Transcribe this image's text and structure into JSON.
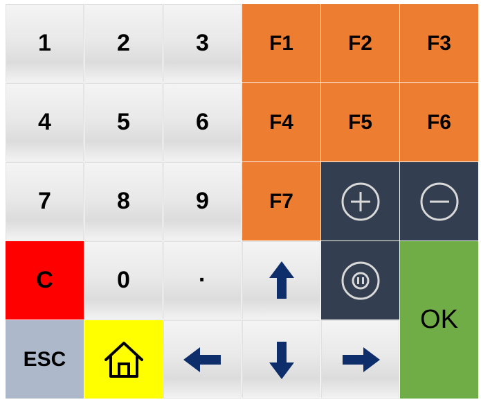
{
  "keypad": {
    "row1": {
      "k1": "1",
      "k2": "2",
      "k3": "3",
      "f1": "F1",
      "f2": "F2",
      "f3": "F3"
    },
    "row2": {
      "k4": "4",
      "k5": "5",
      "k6": "6",
      "f4": "F4",
      "f5": "F5",
      "f6": "F6"
    },
    "row3": {
      "k7": "7",
      "k8": "8",
      "k9": "9",
      "f7": "F7",
      "plus_icon": "plus-circle",
      "minus_icon": "minus-circle"
    },
    "row4": {
      "clear": "C",
      "k0": "0",
      "dot": "·",
      "up_icon": "arrow-up",
      "pause_icon": "pause-circle"
    },
    "row5": {
      "esc": "ESC",
      "home_icon": "home",
      "left_icon": "arrow-left",
      "down_icon": "arrow-down",
      "right_icon": "arrow-right"
    },
    "ok": "OK"
  },
  "colors": {
    "function_keys": "#ed7d31",
    "dark_keys": "#333f50",
    "clear_key": "#ff0000",
    "esc_key": "#adb9ca",
    "home_key": "#ffff00",
    "ok_key": "#70ad47",
    "arrow_color": "#0d2d6b"
  }
}
